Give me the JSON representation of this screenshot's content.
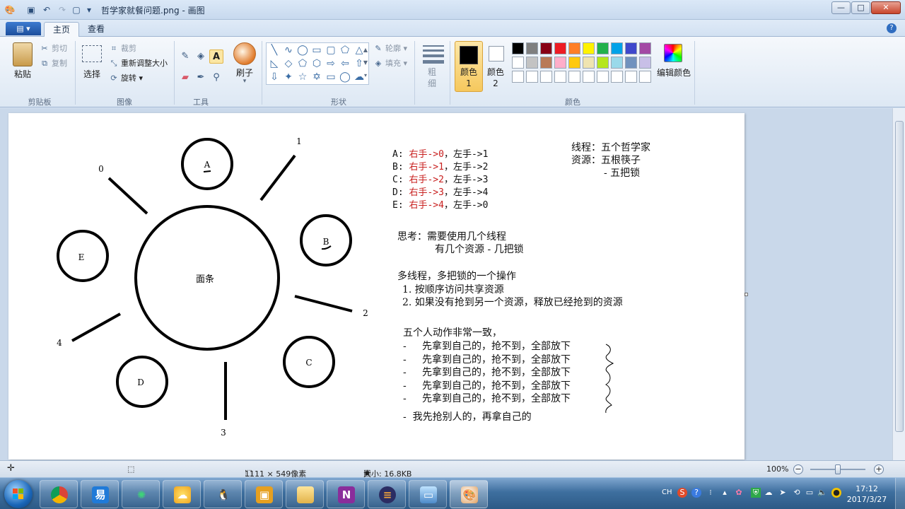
{
  "window": {
    "title": "哲学家就餐问题.png - 画图",
    "controls": {
      "minimize": "—",
      "maximize": "□",
      "close": "✕"
    }
  },
  "ribbon": {
    "file_menu_label": "▾",
    "tabs": [
      {
        "label": "主页",
        "active": true
      },
      {
        "label": "查看",
        "active": false
      }
    ],
    "help": "?",
    "clipboard": {
      "paste": "粘贴",
      "cut": "剪切",
      "copy": "复制",
      "group": "剪贴板"
    },
    "image": {
      "select": "选择",
      "crop": "裁剪",
      "resize": "重新调整大小",
      "rotate": "旋转",
      "group": "图像"
    },
    "tools": {
      "group": "工具",
      "brush": "刷子"
    },
    "shapes": {
      "outline": "轮廓",
      "fill": "填充",
      "group": "形状"
    },
    "size": {
      "label": "粗细"
    },
    "colors": {
      "color1": "颜色 1",
      "color2": "颜色 2",
      "edit": "编辑颜色",
      "group": "颜色",
      "color1_value": "#000000",
      "color2_value": "#ffffff",
      "palette_row1": [
        "#000000",
        "#7f7f7f",
        "#880015",
        "#ed1c24",
        "#ff7f27",
        "#fff200",
        "#22b14c",
        "#00a2e8",
        "#3f48cc",
        "#a349a4"
      ],
      "palette_row2": [
        "#ffffff",
        "#c3c3c3",
        "#b97a57",
        "#ffaec9",
        "#ffc90e",
        "#efe4b0",
        "#b5e61d",
        "#99d9ea",
        "#7092be",
        "#c8bfe7"
      ],
      "palette_row3": [
        "#ffffff",
        "#ffffff",
        "#ffffff",
        "#ffffff",
        "#ffffff",
        "#ffffff",
        "#ffffff",
        "#ffffff",
        "#ffffff",
        "#ffffff"
      ]
    }
  },
  "canvas": {
    "diagram": {
      "center_label": "面条",
      "philosophers": [
        "A",
        "B",
        "C",
        "D",
        "E"
      ],
      "chopsticks": [
        "0",
        "1",
        "2",
        "3",
        "4"
      ]
    },
    "assignments": [
      {
        "p": "A:",
        "right": "右手->0",
        "left": "，左手->1"
      },
      {
        "p": "B:",
        "right": "右手->1",
        "left": "，左手->2"
      },
      {
        "p": "C:",
        "right": "右手->2",
        "left": "，左手->3"
      },
      {
        "p": "D:",
        "right": "右手->3",
        "left": "，左手->4"
      },
      {
        "p": "E:",
        "right": "右手->4",
        "left": "，左手->0"
      }
    ],
    "resources": {
      "line1": "线程：五个哲学家",
      "line2": "资源：五根筷子",
      "line3": "- 五把锁"
    },
    "think": {
      "line1": "思考：需要使用几个线程",
      "line2": "有几个资源 - 几把锁"
    },
    "multi": {
      "title": "多线程，多把锁的一个操作",
      "item1": "1. 按顺序访问共享资源",
      "item2": "2. 如果没有抢到另一个资源，释放已经抢到的资源"
    },
    "consistent": {
      "title": "五个人动作非常一致，",
      "lines": [
        "-     先拿到自己的，抢不到，全部放下",
        "-     先拿到自己的，抢不到，全部放下",
        "-     先拿到自己的，抢不到，全部放下",
        "-     先拿到自己的，抢不到，全部放下",
        "-     先拿到自己的，抢不到，全部放下"
      ],
      "last": "-  我先抢别人的，再拿自己的"
    }
  },
  "status": {
    "dimensions": "1111 × 549像素",
    "size": "大小: 16.8KB",
    "zoom": "100%",
    "zoom_level_percent": 100
  },
  "taskbar": {
    "time": "17:12",
    "date": "2017/3/27",
    "lang": "CH"
  }
}
